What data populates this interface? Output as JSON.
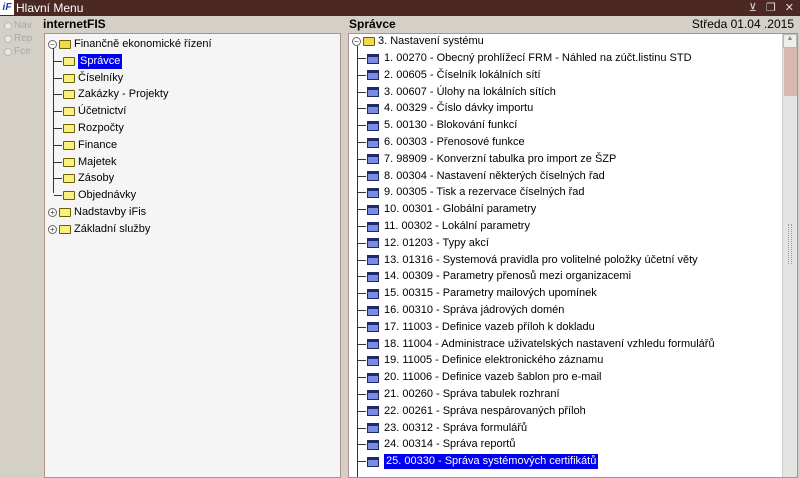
{
  "window": {
    "logo": "iF",
    "title": "Hlavní Menu",
    "controls": "⊻ ❐ ✕"
  },
  "modes": [
    "Nav",
    "Rep",
    "Fce"
  ],
  "left": {
    "header": "internetFIS",
    "root": "Finančně ekonomické řízení",
    "children": [
      "Správce",
      "Číselníky",
      "Zakázky - Projekty",
      "Účetnictví",
      "Rozpočty",
      "Finance",
      "Majetek",
      "Zásoby",
      "Objednávky"
    ],
    "selected": "Správce",
    "others": [
      "Nadstavby iFis",
      "Základní služby"
    ]
  },
  "right": {
    "header": "Správce",
    "date": "Středa  01.04 .2015",
    "root": "3.  Nastavení systému",
    "items": [
      "1.  00270 - Obecný prohlížecí FRM - Náhled na zúčt.listinu STD",
      "2.  00605 - Číselník lokálních sítí",
      "3.  00607 - Úlohy na lokálních sítích",
      "4.  00329 - Číslo dávky importu",
      "5.  00130 - Blokování funkcí",
      "6.  00303 - Přenosové funkce",
      "7.  98909 - Konverzní tabulka pro import ze ŠZP",
      "8.  00304 - Nastavení některých číselných řad",
      "9.  00305 - Tisk a rezervace číselných řad",
      "10. 00301 - Globální parametry",
      "11. 00302 - Lokální parametry",
      "12. 01203 - Typy akcí",
      "13. 01316 - Systemová pravidla pro volitelné položky účetní věty",
      "14. 00309 - Parametry přenosů mezi organizacemi",
      "15. 00315 - Parametry mailových upomínek",
      "16. 00310 - Správa jádrových domén",
      "17. 11003 - Definice vazeb příloh k dokladu",
      "18. 11004 - Administrace uživatelských nastavení vzhledu formulářů",
      "19. 11005 - Definice elektronického záznamu",
      "20. 11006 - Definice vazeb šablon pro e-mail",
      "21. 00260 - Správa tabulek rozhraní",
      "22. 00261 - Správa nespárovaných příloh",
      "23. 00312 - Správa formulářů",
      "24. 00314 - Správa reportů",
      "25. 00330 - Správa systémových certifikátů"
    ],
    "selected_index": 24
  }
}
